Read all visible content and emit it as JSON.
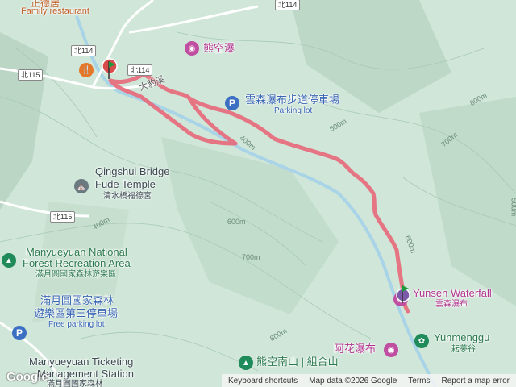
{
  "map": {
    "top_restaurant": "Family restaurant",
    "top_restaurant_cn": "正德居",
    "pois": {
      "bear_waterfall": "熊空瀑",
      "parking_cn": "雲森瀑布步道停車場",
      "parking_en": "Parking lot",
      "temple_en_1": "Qingshui Bridge",
      "temple_en_2": "Fude Temple",
      "temple_cn": "清水橋福德宮",
      "forest_en_1": "Manyueyuan National",
      "forest_en_2": "Forest Recreation Area",
      "forest_cn": "滿月圓國家森林遊樂區",
      "free_parking_cn_1": "滿月圓國家森林",
      "free_parking_cn_2": "遊樂區第三停車場",
      "free_parking_en": "Free parking lot",
      "ticketing_en_1": "Manyueyuan Ticketing",
      "ticketing_en_2": "Management Station",
      "ticketing_cn": "滿月圓國家森林",
      "waterfall_en": "Yunsen Waterfall",
      "waterfall_cn": "雲森瀑布",
      "ahua_waterfall": "阿花瀑布",
      "yunmenggu_en": "Yunmenggu",
      "yunmenggu_cn": "耘夢谷",
      "mountain": "熊空南山 | 組合山",
      "place_cn": "大豹溪"
    },
    "roads": [
      "北114",
      "北114",
      "北115",
      "北115",
      "北114"
    ],
    "contours": [
      "800m",
      "700m",
      "600m",
      "500m",
      "400m",
      "600m",
      "700m",
      "800m",
      "400m",
      "500m"
    ],
    "attribution": {
      "keyboard": "Keyboard shortcuts",
      "data": "Map data ©2026 Google",
      "terms": "Terms",
      "report": "Report a map error"
    },
    "logo": "Google",
    "colors": {
      "track": "#e8687a",
      "terrain": "#cfe6d8",
      "start_marker": "#1e9a3a"
    },
    "icons": {
      "camera": "camera-icon",
      "parking": "parking-icon",
      "temple": "temple-icon",
      "tree": "tree-icon",
      "restaurant": "restaurant-icon"
    }
  }
}
